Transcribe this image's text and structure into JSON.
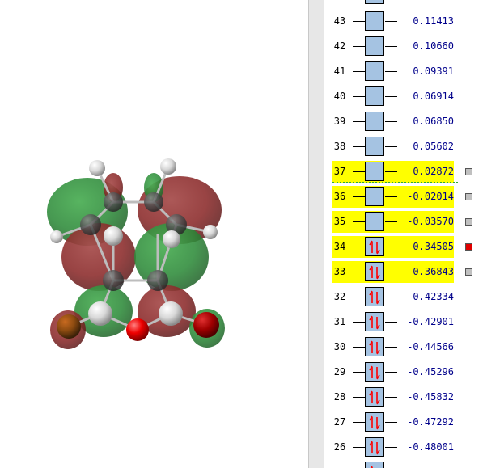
{
  "colors": {
    "highlight": "#ffff00",
    "orbital_box": "#a5c3e2",
    "energy_text": "#00008b",
    "spin_arrow": "#ff0000",
    "homo_lumo_divider": "#2ea63a",
    "selected_marker": "#e00000",
    "unselected_marker": "#c0c0c0",
    "lobe_positive": "#2e8b3a",
    "lobe_negative": "#8b2a2a"
  },
  "icons": {
    "occupied": "spin-pair-arrows-icon",
    "marker": "surface-marker-icon"
  },
  "orbitals": [
    {
      "number": "43",
      "energy": "0.11413",
      "occupied": false,
      "highlighted": false,
      "marker": "none"
    },
    {
      "number": "42",
      "energy": "0.10660",
      "occupied": false,
      "highlighted": false,
      "marker": "none"
    },
    {
      "number": "41",
      "energy": "0.09391",
      "occupied": false,
      "highlighted": false,
      "marker": "none"
    },
    {
      "number": "40",
      "energy": "0.06914",
      "occupied": false,
      "highlighted": false,
      "marker": "none"
    },
    {
      "number": "39",
      "energy": "0.06850",
      "occupied": false,
      "highlighted": false,
      "marker": "none"
    },
    {
      "number": "38",
      "energy": "0.05602",
      "occupied": false,
      "highlighted": false,
      "marker": "none"
    },
    {
      "number": "37",
      "energy": "0.02872",
      "occupied": false,
      "highlighted": true,
      "marker": "gray"
    },
    {
      "number": "36",
      "energy": "-0.02014",
      "occupied": false,
      "highlighted": true,
      "marker": "gray"
    },
    {
      "number": "35",
      "energy": "-0.03570",
      "occupied": false,
      "highlighted": true,
      "marker": "gray"
    },
    {
      "number": "34",
      "energy": "-0.34505",
      "occupied": true,
      "highlighted": true,
      "marker": "red"
    },
    {
      "number": "33",
      "energy": "-0.36843",
      "occupied": true,
      "highlighted": true,
      "marker": "gray"
    },
    {
      "number": "32",
      "energy": "-0.42334",
      "occupied": true,
      "highlighted": false,
      "marker": "none"
    },
    {
      "number": "31",
      "energy": "-0.42901",
      "occupied": true,
      "highlighted": false,
      "marker": "none"
    },
    {
      "number": "30",
      "energy": "-0.44566",
      "occupied": true,
      "highlighted": false,
      "marker": "none"
    },
    {
      "number": "29",
      "energy": "-0.45296",
      "occupied": true,
      "highlighted": false,
      "marker": "none"
    },
    {
      "number": "28",
      "energy": "-0.45832",
      "occupied": true,
      "highlighted": false,
      "marker": "none"
    },
    {
      "number": "27",
      "energy": "-0.47292",
      "occupied": true,
      "highlighted": false,
      "marker": "none"
    },
    {
      "number": "26",
      "energy": "-0.48001",
      "occupied": true,
      "highlighted": false,
      "marker": "none"
    }
  ]
}
